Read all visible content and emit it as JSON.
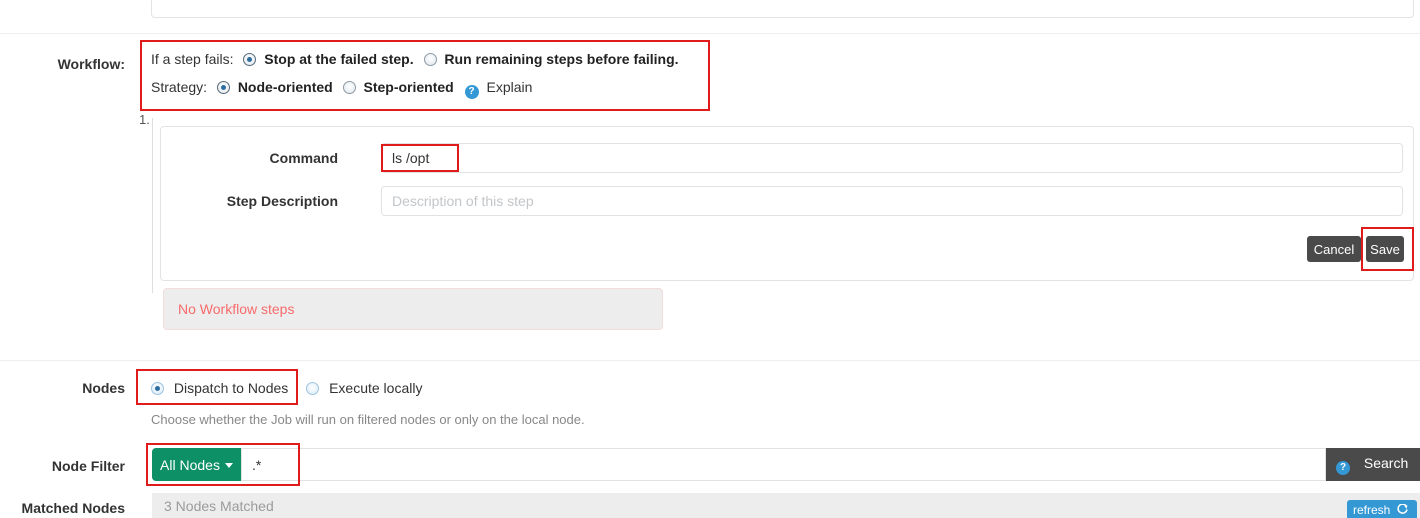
{
  "workflow": {
    "label": "Workflow:",
    "if_step_fails_label": "If a step fails:",
    "option_stop": "Stop at the failed step.",
    "option_run_remaining": "Run remaining steps before failing.",
    "strategy_label": "Strategy:",
    "option_node_oriented": "Node-oriented",
    "option_step_oriented": "Step-oriented",
    "explain_label": "Explain",
    "help_icon_glyph": "?",
    "step_number": "1.",
    "no_steps_message": "No Workflow steps"
  },
  "step_editor": {
    "command_label": "Command",
    "command_value": "ls /opt",
    "step_description_label": "Step Description",
    "step_description_placeholder": "Description of this step",
    "cancel_label": "Cancel",
    "save_label": "Save"
  },
  "nodes": {
    "label": "Nodes",
    "option_dispatch": "Dispatch to Nodes",
    "option_local": "Execute locally",
    "help_text": "Choose whether the Job will run on filtered nodes or only on the local node."
  },
  "node_filter": {
    "label": "Node Filter",
    "all_nodes_button": "All Nodes",
    "filter_value": ".*",
    "search_label": "Search",
    "search_help_glyph": "?"
  },
  "matched_nodes": {
    "label": "Matched Nodes",
    "status": "3 Nodes Matched",
    "refresh_label": "refresh"
  },
  "colors": {
    "highlight": "#e01b1b",
    "accent_green": "#0d9065",
    "accent_blue": "#3498d5",
    "button_dark": "#4a4a4a",
    "alert_text": "#f76b6b"
  }
}
